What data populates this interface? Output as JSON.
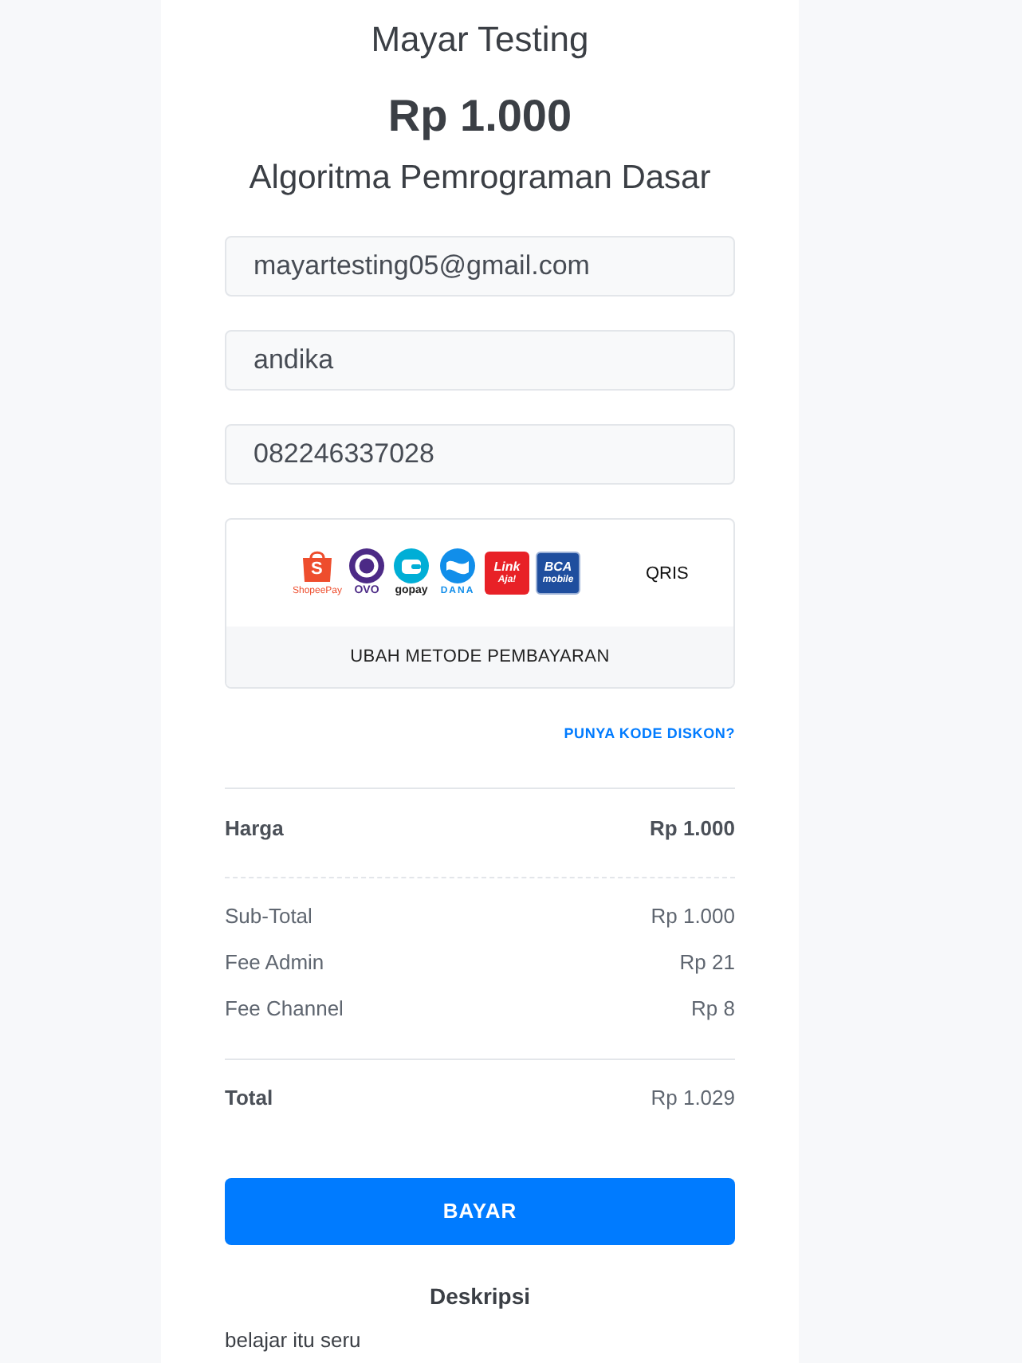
{
  "header": {
    "store_name": "Mayar Testing",
    "price": "Rp 1.000",
    "product_name": "Algoritma Pemrograman Dasar"
  },
  "fields": [
    {
      "value": "mayartesting05@gmail.com"
    },
    {
      "value": "andika"
    },
    {
      "value": "082246337028"
    }
  ],
  "payment_method": {
    "logos": [
      {
        "kind": "bag",
        "letter": "S",
        "caption": "ShopeePay"
      },
      {
        "kind": "ring",
        "caption": "OVO"
      },
      {
        "kind": "wallet",
        "caption": "gopay"
      },
      {
        "kind": "wave",
        "caption": "DANA"
      },
      {
        "kind": "red-tile",
        "lines": [
          "Link",
          "Aja!"
        ]
      },
      {
        "kind": "blue-tile",
        "lines": [
          "BCA",
          "mobile"
        ]
      }
    ],
    "label": "QRIS",
    "change_button": "UBAH METODE PEMBAYARAN"
  },
  "discount_link": "PUNYA KODE DISKON?",
  "price_row": {
    "label": "Harga",
    "amount": "Rp 1.000"
  },
  "breakdown": [
    {
      "label": "Sub-Total",
      "amount": "Rp 1.000"
    },
    {
      "label": "Fee Admin",
      "amount": "Rp 21"
    },
    {
      "label": "Fee Channel",
      "amount": "Rp 8"
    }
  ],
  "total": {
    "label": "Total",
    "amount": "Rp 1.029"
  },
  "pay_button": "BAYAR",
  "description": {
    "heading": "Deskripsi",
    "text": "belajar itu seru"
  }
}
